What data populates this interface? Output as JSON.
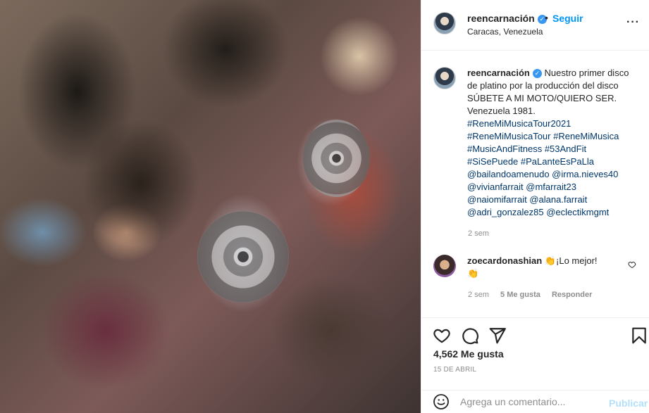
{
  "header": {
    "username": "reencarnación",
    "separator": "•",
    "follow_label": "Seguir",
    "location": "Caracas, Venezuela",
    "more": "···"
  },
  "caption": {
    "username": "reencarnación",
    "text": "Nuestro primer disco de platino por la producción del disco SÚBETE A MI MOTO/QUIERO SER. Venezuela 1981.",
    "tags": [
      "#ReneMiMusicaTour2021",
      "#ReneMiMusicaTour #ReneMiMusica",
      "#MusicAndFitness #53AndFit",
      "#SiSePuede #PaLanteEsPaLla",
      "@bailandoamenudo @irma.nieves40",
      "@vivianfarrait @mfarrait23",
      "@naiomifarrait @alana.farrait",
      "@adri_gonzalez85 @eclectikmgmt"
    ],
    "time": "2 sem"
  },
  "comment": {
    "username": "zoecardonashian",
    "text": "¡Lo mejor!",
    "time": "2 sem",
    "likes": "5 Me gusta",
    "reply": "Responder"
  },
  "post": {
    "likes": "4,562 Me gusta",
    "date": "15 DE ABRIL"
  },
  "add_comment": {
    "placeholder": "Agrega un comentario...",
    "publish_label": "Publicar"
  },
  "colors": {
    "accent": "#0095f6",
    "verified": "#3897f0",
    "link": "#00376b",
    "muted": "#8e8e8e",
    "publish_disabled": "#b2dffc"
  },
  "icons": {
    "verified": "verified-badge-icon",
    "like": "heart-icon",
    "comment": "comment-icon",
    "share": "paper-plane-icon",
    "save": "bookmark-icon",
    "emoji": "smiley-icon",
    "clap": "clapping-hands-icon"
  }
}
